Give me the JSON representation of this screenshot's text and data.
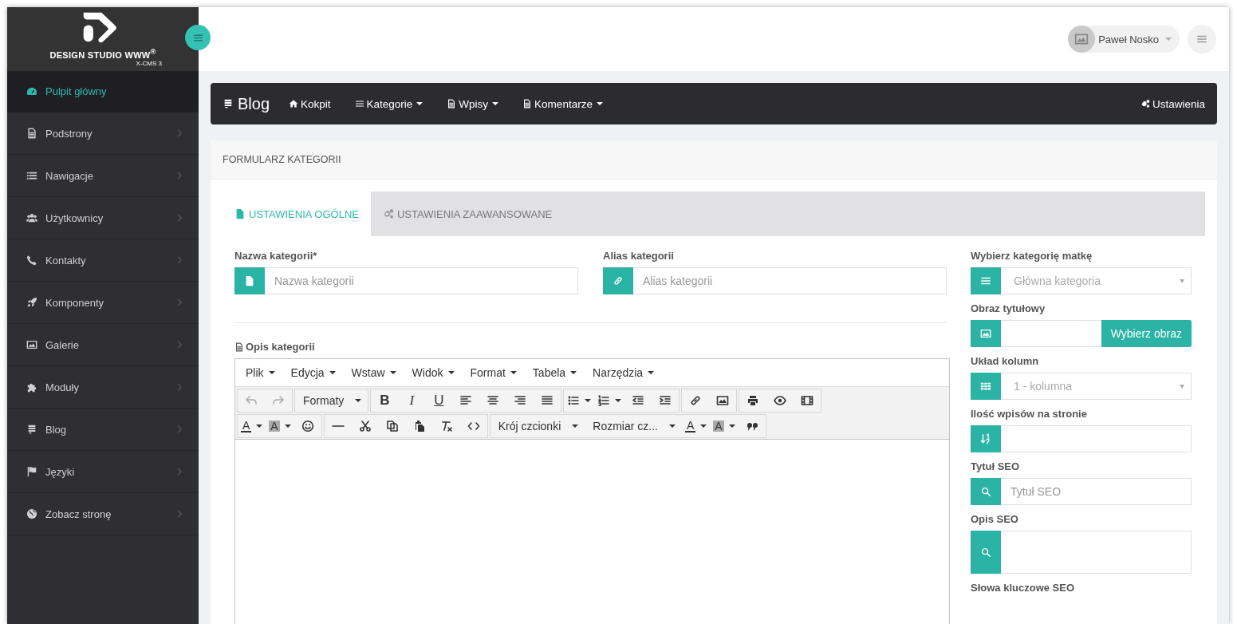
{
  "logo": {
    "name": "DESIGN STUDIO WWW$^{®}$",
    "sub": "X-CMS 3"
  },
  "sidebar": {
    "items": [
      {
        "label": "Pulpit główny",
        "selected": true
      },
      {
        "label": "Podstrony",
        "selected": false
      },
      {
        "label": "Nawigacje",
        "selected": false
      },
      {
        "label": "Użytkownicy",
        "selected": false
      },
      {
        "label": "Kontakty",
        "selected": false
      },
      {
        "label": "Komponenty",
        "selected": false
      },
      {
        "label": "Galerie",
        "selected": false
      },
      {
        "label": "Moduły",
        "selected": false
      },
      {
        "label": "Blog",
        "selected": false
      },
      {
        "label": "Języki",
        "selected": false
      },
      {
        "label": "Zobacz stronę",
        "selected": false
      }
    ]
  },
  "user": {
    "name": "Paweł Nosko"
  },
  "module_nav": {
    "brand": "Blog",
    "items": [
      {
        "label": "Kokpit",
        "dropdown": false
      },
      {
        "label": "Kategorie",
        "dropdown": true
      },
      {
        "label": "Wpisy",
        "dropdown": true
      },
      {
        "label": "Komentarze",
        "dropdown": true
      }
    ],
    "right": "Ustawienia"
  },
  "panel": {
    "title": "FORMULARZ KATEGORII",
    "tabs": [
      {
        "label": "USTAWIENIA OGÓLNE",
        "selected": true
      },
      {
        "label": "USTAWIENIA ZAAWANSOWANE",
        "selected": false
      }
    ],
    "fields": [
      {
        "label": "Nazwa kategorii*",
        "placeholder": "Nazwa kategorii"
      },
      {
        "label": "Alias kategorii",
        "placeholder": "Alias kategorii"
      }
    ],
    "description_label": "Opis kategorii",
    "editor": {
      "menu": [
        "Plik",
        "Edycja",
        "Wstaw",
        "Widok",
        "Format",
        "Tabela",
        "Narzędzia"
      ],
      "toolbar": [
        [
          [
            {
              "kind": "icon",
              "disabled": true
            },
            {
              "kind": "icon",
              "disabled": true
            }
          ],
          [
            {
              "kind": "dropdown",
              "label": "Formaty"
            }
          ],
          [
            {
              "kind": "char",
              "label": "B"
            },
            {
              "kind": "char",
              "label": "I"
            },
            {
              "kind": "char",
              "label": "U"
            },
            {
              "kind": "icon"
            },
            {
              "kind": "icon"
            },
            {
              "kind": "icon"
            },
            {
              "kind": "icon"
            }
          ],
          [
            {
              "kind": "split"
            },
            {
              "kind": "split"
            },
            {
              "kind": "icon"
            },
            {
              "kind": "icon"
            }
          ],
          [
            {
              "kind": "icon"
            },
            {
              "kind": "icon"
            }
          ],
          [
            {
              "kind": "icon"
            },
            {
              "kind": "icon"
            },
            {
              "kind": "icon"
            }
          ]
        ],
        [
          [
            {
              "kind": "color",
              "label": "A"
            },
            {
              "kind": "bgcolor",
              "label": "A"
            },
            {
              "kind": "icon"
            }
          ],
          [
            {
              "kind": "icon"
            },
            {
              "kind": "icon"
            },
            {
              "kind": "icon"
            },
            {
              "kind": "icon"
            },
            {
              "kind": "icon"
            },
            {
              "kind": "icon"
            }
          ],
          [
            {
              "kind": "dropdown",
              "label": "Krój czcionki"
            },
            {
              "kind": "dropdown",
              "label": "Rozmiar cz..."
            },
            {
              "kind": "color",
              "label": "A"
            },
            {
              "kind": "bgcolor",
              "label": "A"
            },
            {
              "kind": "icon"
            }
          ]
        ]
      ]
    },
    "side_fields": [
      {
        "kind": "select",
        "label": "Wybierz kategorię matkę",
        "value": "Główna kategoria"
      },
      {
        "kind": "image",
        "label": "Obraz tytułowy",
        "button": "Wybierz obraz"
      },
      {
        "kind": "select",
        "label": "Układ kolumn",
        "value": "1 - kolumna"
      },
      {
        "kind": "input",
        "label": "Ilość wpisów na stronie"
      },
      {
        "kind": "input",
        "label": "Tytuł SEO",
        "placeholder": "Tytuł SEO"
      },
      {
        "kind": "textarea",
        "label": "Opis SEO"
      },
      {
        "kind": "heading",
        "label": "Słowa kluczowe SEO"
      }
    ]
  }
}
